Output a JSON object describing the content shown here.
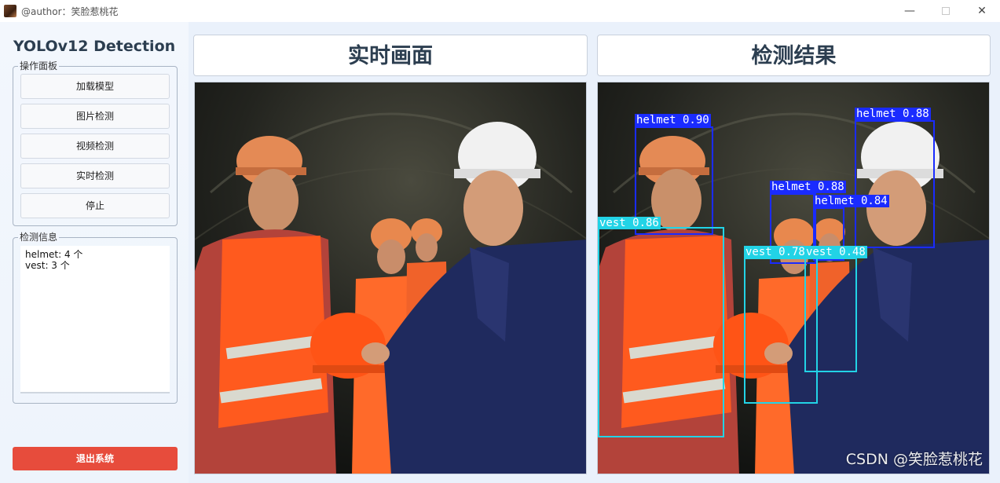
{
  "window": {
    "title": "@author：笑脸惹桃花",
    "controls": {
      "minimize": "—",
      "close": "✕"
    }
  },
  "sidebar": {
    "title": "YOLOv12 Detection",
    "ops_group_title": "操作面板",
    "buttons": {
      "load_model": "加载模型",
      "image_detect": "图片检测",
      "video_detect": "视频检测",
      "realtime_detect": "实时检测",
      "stop": "停止"
    },
    "info_group_title": "检测信息",
    "info_lines": [
      "helmet: 4 个",
      "vest: 3 个"
    ],
    "exit_button": "退出系统"
  },
  "panels": {
    "live_title": "实时画面",
    "result_title": "检测结果"
  },
  "detections": [
    {
      "label": "helmet 0.90",
      "color": "#1a2bff"
    },
    {
      "label": "helmet 0.88",
      "color": "#1a2bff"
    },
    {
      "label": "helmet 0.88",
      "color": "#1a2bff"
    },
    {
      "label": "helmet 0.84",
      "color": "#1a2bff"
    },
    {
      "label": "vest 0.86",
      "color": "#22d3e6"
    },
    {
      "label": "vest 0.78",
      "color": "#22d3e6"
    },
    {
      "label": "vest 0.48",
      "color": "#22d3e6"
    }
  ],
  "watermark": "CSDN @笑脸惹桃花",
  "colors": {
    "exit_button": "#e74c3c",
    "helmet_box": "#1a2bff",
    "vest_box": "#22d3e6",
    "title_text": "#2c3e50"
  }
}
